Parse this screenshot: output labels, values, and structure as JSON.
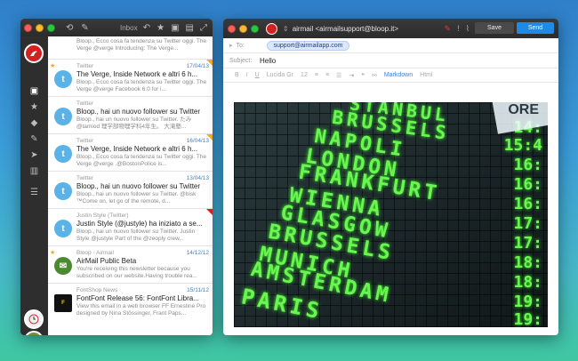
{
  "inbox": {
    "title": "Inbox",
    "messages": [
      {
        "sender": "",
        "date": "",
        "subject": "",
        "preview": "Bloop., Ecco cosa fa tendenza su Twitter oggi. The Verge @verge Introducing: The Verge..."
      },
      {
        "sender": "Twitter",
        "date": "17/04/13",
        "subject": "The Verge, Inside Network e altri 6 h...",
        "preview": "Bloop., Ecco cosa fa tendenza su Twitter oggi. The Verge @verge Facebook 6.0 for i..."
      },
      {
        "sender": "Twitter",
        "date": "",
        "subject": "Bloop., hai un nuovo follower su Twitter",
        "preview": "Bloop., hai un nuovo follower su Twitter. たみ @tamiod 理学部物理学科4年生。 大滝塾..."
      },
      {
        "sender": "Twitter",
        "date": "16/04/13",
        "subject": "The Verge, Inside Network e altri 6 h...",
        "preview": "Bloop., Ecco cosa fa tendenza su Twitter oggi. The Verge @verge .@BostonPolice is..."
      },
      {
        "sender": "Twitter",
        "date": "13/04/13",
        "subject": "Bloop., hai un nuovo follower su Twitter",
        "preview": "Bloop., hai un nuovo follower su Twitter. @bisk ™Come on, let go of the remote, d..."
      },
      {
        "sender": "Justin Style (Twitter)",
        "date": "",
        "subject": "Justin Style (@justyle) ha iniziato a se...",
        "preview": "Bloop., hai un nuovo follower su Twitter. Justin Style @justyle Part of the @zeoply crew..."
      },
      {
        "sender": "Bloop - Airmail",
        "date": "14/12/12",
        "subject": "AirMail Public Beta",
        "preview": "You're receiving this newsletter because you subscribed on our website.Having trouble rea..."
      },
      {
        "sender": "FontShop News",
        "date": "15/11/12",
        "subject": "FontFont Release 56: FontFont Libra...",
        "preview": "View this email in a web browser FF Ernestine Pro designed by Nina Stössinger, Frant Paps..."
      }
    ]
  },
  "compose": {
    "account": "airmail <airmailsupport@bloop.it>",
    "save_label": "Save",
    "send_label": "Send",
    "to_label": "To:",
    "to_value": "support@airmailapp.com",
    "subject_label": "Subject:",
    "subject_value": "Hello",
    "font_name": "Lucida Gr",
    "font_size": "12",
    "markdown_label": "Markdown",
    "html_label": "Html"
  },
  "board": {
    "cities": [
      "STANBUL",
      "BRUSSELS",
      "NAPOLI",
      "LONDON",
      "FRANKFURT",
      "WIENNA",
      "GLASGOW",
      "BRUSSELS",
      "MUNICH",
      "AMSTERDAM",
      "PARIS"
    ],
    "numbers": [
      "14:",
      "15:4",
      "16:",
      "16:",
      "16:",
      "17:",
      "17:",
      "18:",
      "18:",
      "19:",
      "19:"
    ],
    "corner_text": "ORE"
  },
  "colors": {
    "accent": "#1f8ae6",
    "send": "#1f8ae6",
    "airmail_red": "#d42020",
    "led_green": "#6cf552"
  }
}
